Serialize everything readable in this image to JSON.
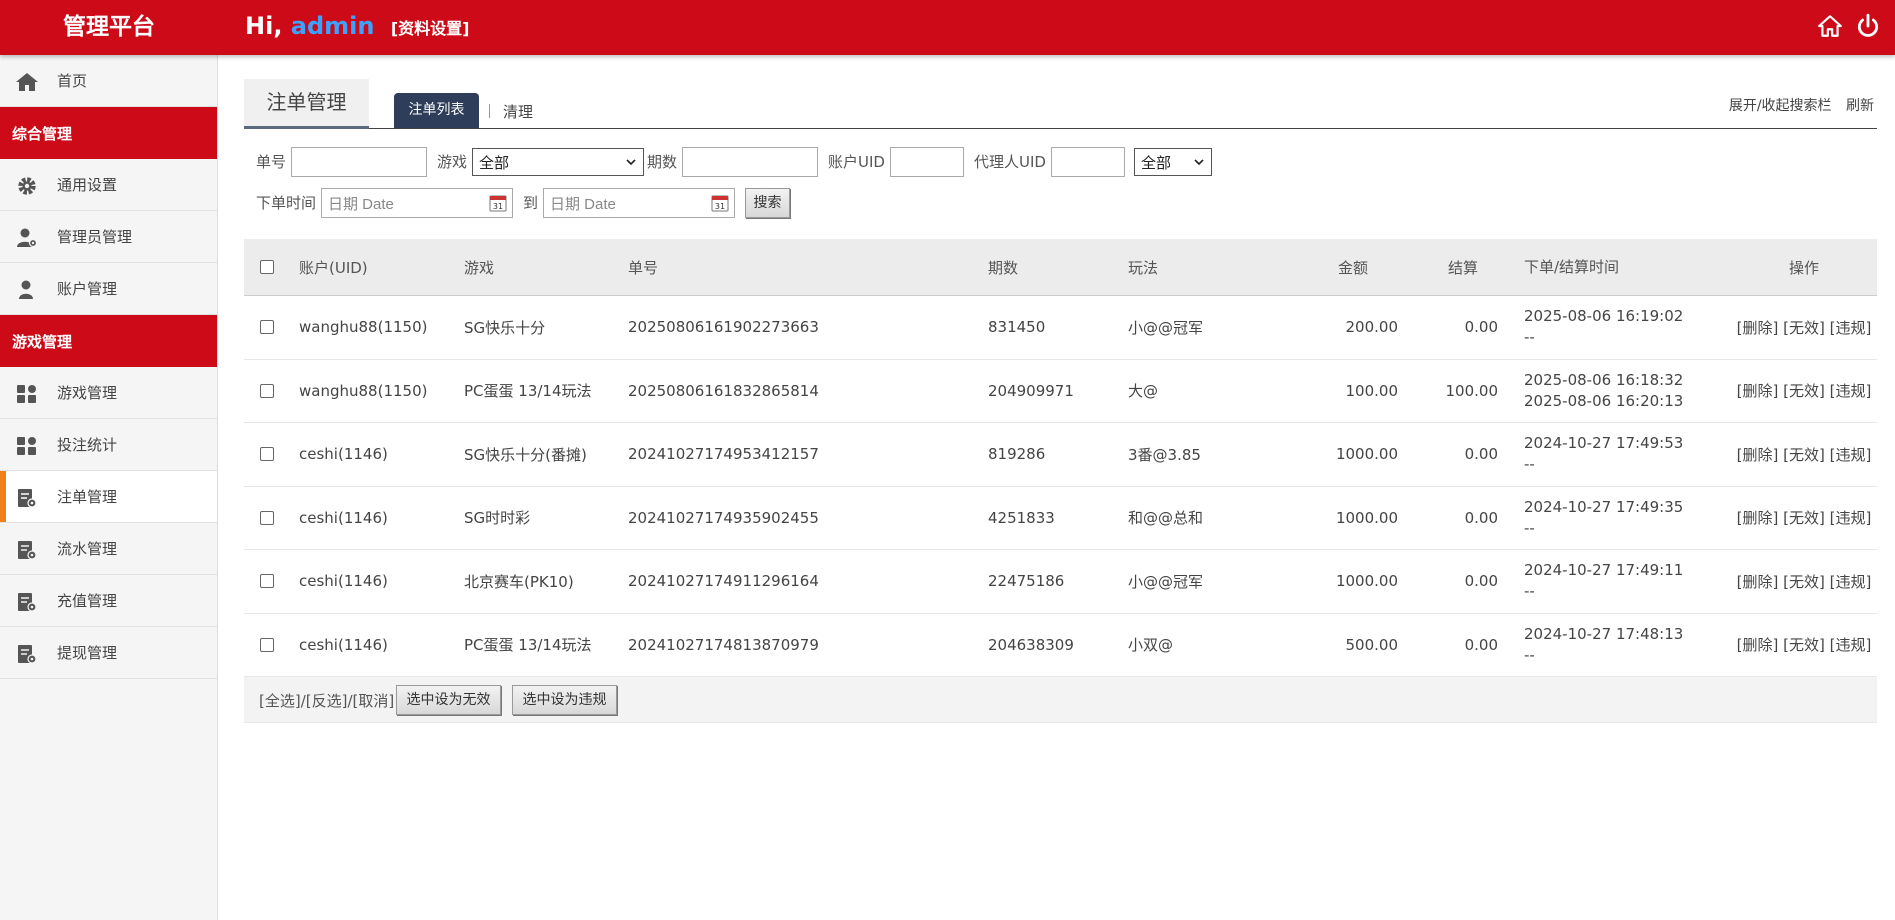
{
  "header": {
    "brand": "管理平台",
    "greeting": "Hi, ",
    "username": "admin",
    "profile_link": "[资料设置]",
    "home_icon": "home-icon",
    "power_icon": "power-icon"
  },
  "sidebar": {
    "home": "首页",
    "section1": "综合管理",
    "general_settings": "通用设置",
    "admin_mgmt": "管理员管理",
    "account_mgmt": "账户管理",
    "section2": "游戏管理",
    "game_mgmt": "游戏管理",
    "bet_stats": "投注统计",
    "order_mgmt": "注单管理",
    "flow_mgmt": "流水管理",
    "recharge_mgmt": "充值管理",
    "withdraw_mgmt": "提现管理"
  },
  "main": {
    "page_title": "注单管理",
    "tab_list": "注单列表",
    "tab_clear": "清理",
    "toggle_search": "展开/收起搜索栏",
    "refresh": "刷新"
  },
  "search": {
    "order_no_label": "单号",
    "game_label": "游戏",
    "game_selected": "全部",
    "period_label": "期数",
    "uid_label": "账户UID",
    "agent_uid_label": "代理人UID",
    "status_selected": "全部",
    "time_label": "下单时间",
    "date_placeholder": "日期 Date",
    "to_label": "到",
    "search_button": "搜索"
  },
  "table": {
    "headers": {
      "account": "账户(UID)",
      "game": "游戏",
      "order_no": "单号",
      "period": "期数",
      "play": "玩法",
      "amount": "金额",
      "settle": "结算",
      "time": "下单/结算时间",
      "ops": "操作"
    },
    "rows": [
      {
        "account": "wanghu88(1150)",
        "game": "SG快乐十分",
        "order_no": "20250806161902273663",
        "period": "831450",
        "play": "小@@冠军",
        "amount": "200.00",
        "settle": "0.00",
        "time1": "2025-08-06 16:19:02",
        "time2": "--"
      },
      {
        "account": "wanghu88(1150)",
        "game": "PC蛋蛋 13/14玩法",
        "order_no": "20250806161832865814",
        "period": "204909971",
        "play": "大@",
        "amount": "100.00",
        "settle": "100.00",
        "time1": "2025-08-06 16:18:32",
        "time2": "2025-08-06 16:20:13"
      },
      {
        "account": "ceshi(1146)",
        "game": "SG快乐十分(番摊)",
        "order_no": "20241027174953412157",
        "period": "819286",
        "play": "3番@3.85",
        "amount": "1000.00",
        "settle": "0.00",
        "time1": "2024-10-27 17:49:53",
        "time2": "--"
      },
      {
        "account": "ceshi(1146)",
        "game": "SG时时彩",
        "order_no": "20241027174935902455",
        "period": "4251833",
        "play": "和@@总和",
        "amount": "1000.00",
        "settle": "0.00",
        "time1": "2024-10-27 17:49:35",
        "time2": "--"
      },
      {
        "account": "ceshi(1146)",
        "game": "北京赛车(PK10)",
        "order_no": "20241027174911296164",
        "period": "22475186",
        "play": "小@@冠军",
        "amount": "1000.00",
        "settle": "0.00",
        "time1": "2024-10-27 17:49:11",
        "time2": "--"
      },
      {
        "account": "ceshi(1146)",
        "game": "PC蛋蛋 13/14玩法",
        "order_no": "20241027174813870979",
        "period": "204638309",
        "play": "小双@",
        "amount": "500.00",
        "settle": "0.00",
        "time1": "2024-10-27 17:48:13",
        "time2": "--"
      }
    ],
    "ops": "[删除] [无效] [违规]",
    "footer_select": "[全选]/[反选]/[取消]",
    "btn_invalid": "选中设为无效",
    "btn_violation": "选中设为违规"
  }
}
